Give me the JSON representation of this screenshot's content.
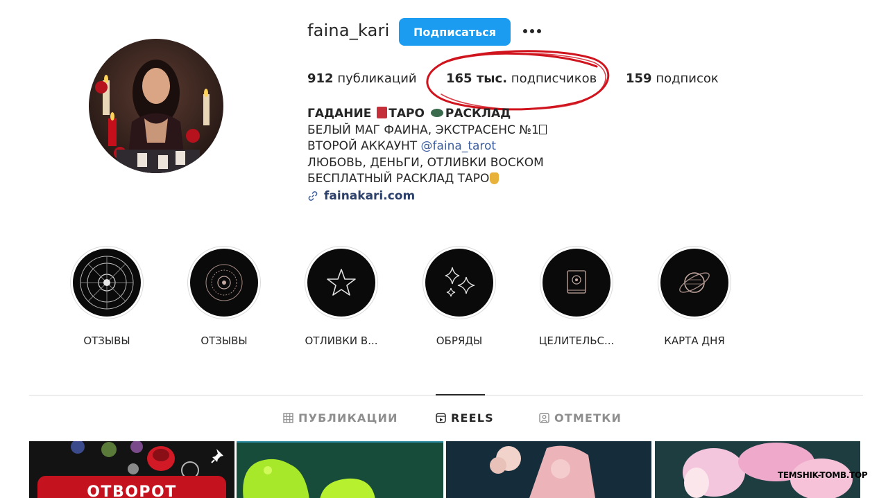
{
  "profile": {
    "username": "faina_kari",
    "follow_label": "Подписаться",
    "more_icon": "more-horizontal-icon"
  },
  "stats": {
    "posts_count": "912",
    "posts_label": "публикаций",
    "followers_count": "165 тыс.",
    "followers_label": "подписчиков",
    "following_count": "159",
    "following_label": "подписок"
  },
  "bio": {
    "name_part1": "ГАДАНИЕ",
    "name_part2": "ТАРО",
    "name_part3": "РАСКЛАД",
    "line1": "БЕЛЫЙ МАГ ФАИНА, ЭКСТРАСЕНС №1",
    "line2_prefix": "ВТОРОЙ АККАУНТ ",
    "line2_mention": "@faina_tarot",
    "line3": "ЛЮБОВЬ, ДЕНЬГИ, ОТЛИВКИ ВОСКОМ",
    "line4": "БЕСПЛАТНЫЙ РАСКЛАД ТАРО",
    "link": "fainakari.com"
  },
  "highlights": [
    {
      "label": "ОТЗЫВЫ",
      "icon": "zodiac-wheel-icon"
    },
    {
      "label": "ОТЗЫВЫ",
      "icon": "mandala-icon"
    },
    {
      "label": "ОТЛИВКИ В...",
      "icon": "star-icon"
    },
    {
      "label": "ОБРЯДЫ",
      "icon": "sparkles-icon"
    },
    {
      "label": "ЦЕЛИТЕЛЬС...",
      "icon": "book-icon"
    },
    {
      "label": "КАРТА ДНЯ",
      "icon": "planet-icon"
    }
  ],
  "tabs": [
    {
      "label": "ПУБЛИКАЦИИ",
      "icon": "grid-icon",
      "active": false
    },
    {
      "label": "REELS",
      "icon": "reels-icon",
      "active": true
    },
    {
      "label": "ОТМЕТКИ",
      "icon": "tagged-icon",
      "active": false
    }
  ],
  "grid": {
    "post1_banner": "ОТВОРОТ"
  },
  "watermark": "TEMSHIK-TOMB.TOP",
  "colors": {
    "follow_button": "#1b9cf0",
    "annotation_circle": "#d0141e",
    "mention": "#3d5fa0"
  }
}
